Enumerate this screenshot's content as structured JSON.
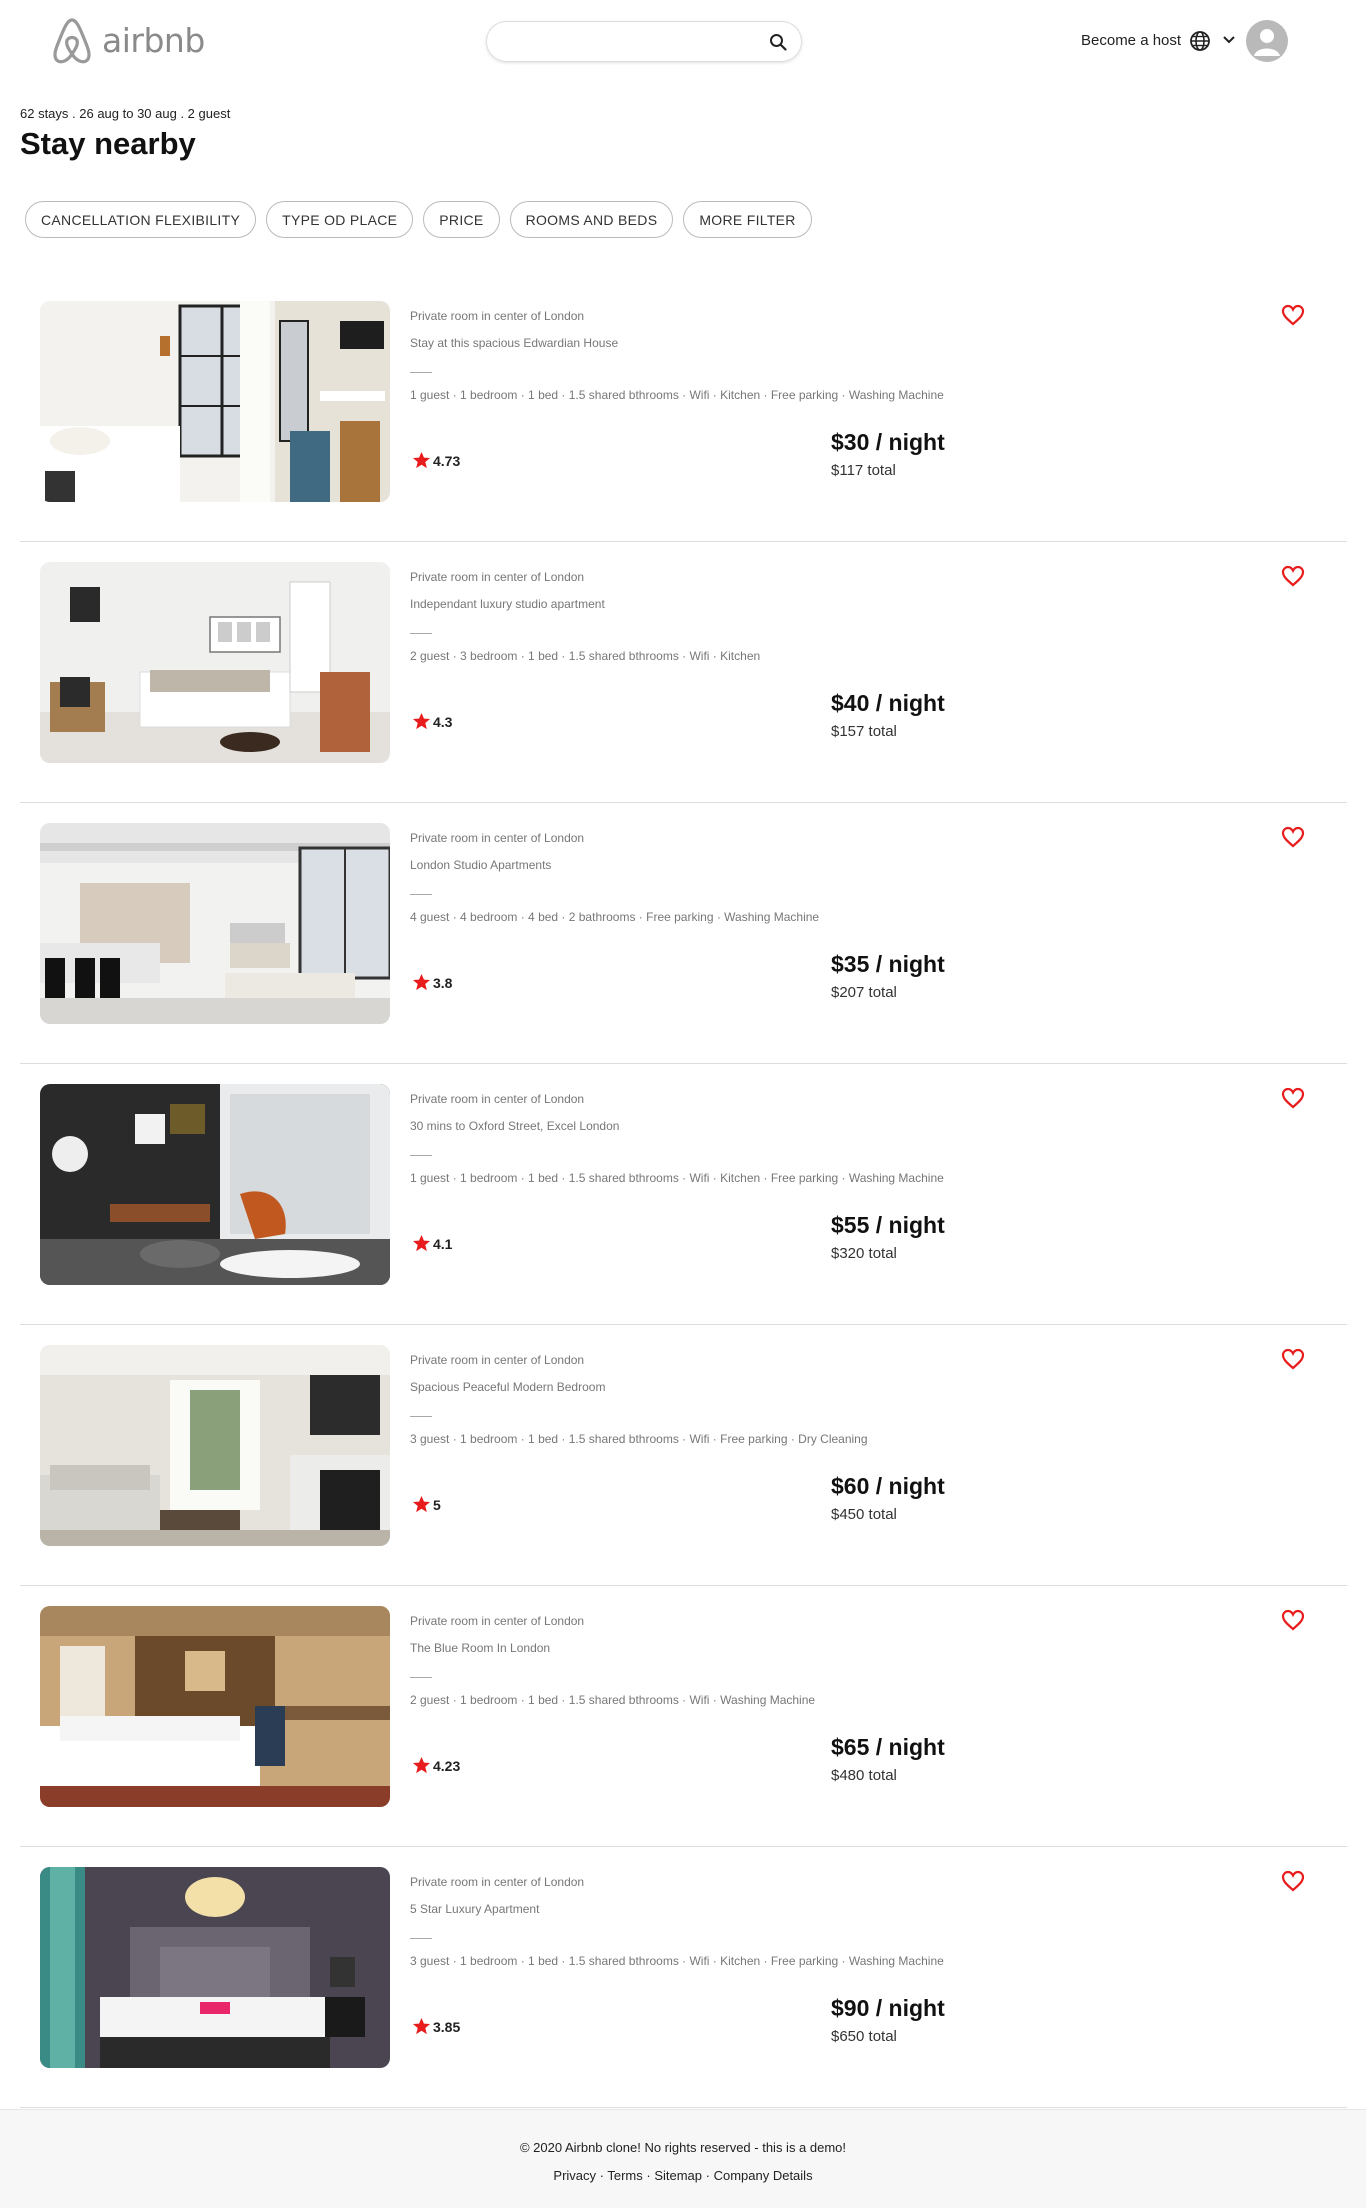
{
  "header": {
    "logo_text": "airbnb",
    "search_placeholder": "",
    "host_label": "Become a host",
    "brand_color": "#ff5a5f"
  },
  "summary": {
    "subline": "62 stays . 26 aug to 30 aug . 2 guest",
    "title": "Stay nearby"
  },
  "filters": [
    "CANCELLATION FLEXIBILITY",
    "TYPE OD PLACE",
    "PRICE",
    "ROOMS AND BEDS",
    "MORE FILTER"
  ],
  "listings": [
    {
      "type": "Private room in center of London",
      "title": "Stay at this spacious Edwardian House",
      "amenities": "1 guest · 1 bedroom · 1 bed · 1.5 shared bthrooms · Wifi · Kitchen · Free parking · Washing Machine",
      "rating": "4.73",
      "price": "$30 / night",
      "total": "$117 total"
    },
    {
      "type": "Private room in center of London",
      "title": "Independant luxury studio apartment",
      "amenities": "2 guest · 3 bedroom · 1 bed · 1.5 shared bthrooms · Wifi · Kitchen",
      "rating": "4.3",
      "price": "$40 / night",
      "total": "$157 total"
    },
    {
      "type": "Private room in center of London",
      "title": "London Studio Apartments",
      "amenities": "4 guest · 4 bedroom · 4 bed · 2 bathrooms · Free parking · Washing Machine",
      "rating": "3.8",
      "price": "$35 / night",
      "total": "$207 total"
    },
    {
      "type": "Private room in center of London",
      "title": "30 mins to Oxford Street, Excel London",
      "amenities": "1 guest · 1 bedroom · 1 bed · 1.5 shared bthrooms · Wifi · Kitchen · Free parking · Washing Machine",
      "rating": "4.1",
      "price": "$55 / night",
      "total": "$320 total"
    },
    {
      "type": "Private room in center of London",
      "title": "Spacious Peaceful Modern Bedroom",
      "amenities": "3 guest · 1 bedroom · 1 bed · 1.5 shared bthrooms · Wifi · Free parking · Dry Cleaning",
      "rating": "5",
      "price": "$60 / night",
      "total": "$450 total"
    },
    {
      "type": "Private room in center of London",
      "title": "The Blue Room In London",
      "amenities": "2 guest · 1 bedroom · 1 bed · 1.5 shared bthrooms · Wifi · Washing Machine",
      "rating": "4.23",
      "price": "$65 / night",
      "total": "$480 total"
    },
    {
      "type": "Private room in center of London",
      "title": "5 Star Luxury Apartment",
      "amenities": "3 guest · 1 bedroom · 1 bed · 1.5 shared bthrooms · Wifi · Kitchen · Free parking · Washing Machine",
      "rating": "3.85",
      "price": "$90 / night",
      "total": "$650 total"
    }
  ],
  "footer": {
    "copyright": "© 2020 Airbnb clone! No rights reserved - this is a demo!",
    "links": [
      "Privacy",
      "Terms",
      "Sitemap",
      "Company Details"
    ]
  }
}
